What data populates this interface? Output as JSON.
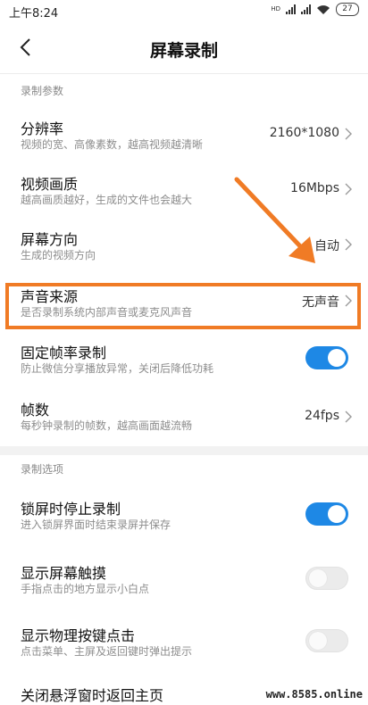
{
  "status_bar": {
    "time": "上午8:24",
    "signal_label": "HD",
    "battery": "27"
  },
  "header": {
    "title": "屏幕录制",
    "back_icon": "chevron-left-icon"
  },
  "sections": [
    {
      "label": "录制参数",
      "items": [
        {
          "title": "分辨率",
          "desc": "视频的宽、高像素数，越高视频越清晰",
          "value": "2160*1080"
        },
        {
          "title": "视频画质",
          "desc": "越高画质越好，生成的文件也会越大",
          "value": "16Mbps"
        },
        {
          "title": "屏幕方向",
          "desc": "生成的视频方向",
          "value": "自动"
        },
        {
          "title": "声音来源",
          "desc": "是否录制系统内部声音或麦克风声音",
          "value": "无声音"
        },
        {
          "title": "固定帧率录制",
          "desc": "防止微信分享播放异常，关闭后降低功耗",
          "toggle": true
        },
        {
          "title": "帧数",
          "desc": "每秒钟录制的帧数，越高画面越流畅",
          "value": "24fps"
        }
      ]
    },
    {
      "label": "录制选项",
      "items": [
        {
          "title": "锁屏时停止录制",
          "desc": "进入锁屏界面时结束录屏并保存",
          "toggle": true
        },
        {
          "title": "显示屏幕触摸",
          "desc": "手指点击的地方显示小白点",
          "toggle": false
        },
        {
          "title": "显示物理按键点击",
          "desc": "点击菜单、主屏及返回键时弹出提示",
          "toggle": false
        },
        {
          "title": "关闭悬浮窗时返回主页"
        }
      ]
    }
  ],
  "annotation": {
    "color": "#f07b25"
  },
  "colors": {
    "toggle_on": "#1e88e5",
    "toggle_off": "#ebebeb"
  },
  "watermark": "www.8585.online"
}
